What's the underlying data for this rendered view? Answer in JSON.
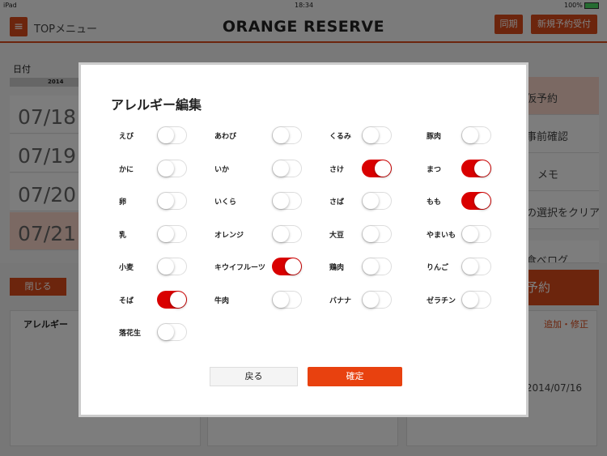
{
  "status": {
    "device": "iPad",
    "time": "18:34",
    "battery": "100%"
  },
  "header": {
    "menu_label": "TOPメニュー",
    "title": "ORANGE RESERVE",
    "sync": "同期",
    "new_reservation": "新規予約受付"
  },
  "dates": {
    "label": "日付",
    "year": "2014",
    "rows": [
      "07/18",
      "07/19",
      "07/20",
      "07/21"
    ]
  },
  "side": {
    "items": [
      "仮予約",
      "事前確認",
      "メモ",
      "の選択をクリア",
      "食べログ"
    ]
  },
  "bottom": {
    "close": "閉じる",
    "reserve": "予約",
    "allergy_title": "アレルギー",
    "edit_link": "追加・修正",
    "date": "2014/07/16"
  },
  "modal": {
    "title": "アレルギー編集",
    "back": "戻る",
    "confirm": "確定",
    "items": [
      {
        "label": "えび",
        "on": false
      },
      {
        "label": "あわび",
        "on": false
      },
      {
        "label": "くるみ",
        "on": false
      },
      {
        "label": "豚肉",
        "on": false
      },
      {
        "label": "かに",
        "on": false
      },
      {
        "label": "いか",
        "on": false
      },
      {
        "label": "さけ",
        "on": true
      },
      {
        "label": "まつ",
        "on": true
      },
      {
        "label": "卵",
        "on": false
      },
      {
        "label": "いくら",
        "on": false
      },
      {
        "label": "さば",
        "on": false
      },
      {
        "label": "もも",
        "on": true
      },
      {
        "label": "乳",
        "on": false
      },
      {
        "label": "オレンジ",
        "on": false
      },
      {
        "label": "大豆",
        "on": false
      },
      {
        "label": "やまいも",
        "on": false
      },
      {
        "label": "小麦",
        "on": false
      },
      {
        "label": "キウイフルーツ",
        "on": true
      },
      {
        "label": "鶏肉",
        "on": false
      },
      {
        "label": "りんご",
        "on": false
      },
      {
        "label": "そば",
        "on": true
      },
      {
        "label": "牛肉",
        "on": false
      },
      {
        "label": "バナナ",
        "on": false
      },
      {
        "label": "ゼラチン",
        "on": false
      },
      {
        "label": "落花生",
        "on": false
      }
    ]
  },
  "colors": {
    "accent": "#d84a1b",
    "toggle_on": "#d90000",
    "confirm": "#e8410f"
  }
}
